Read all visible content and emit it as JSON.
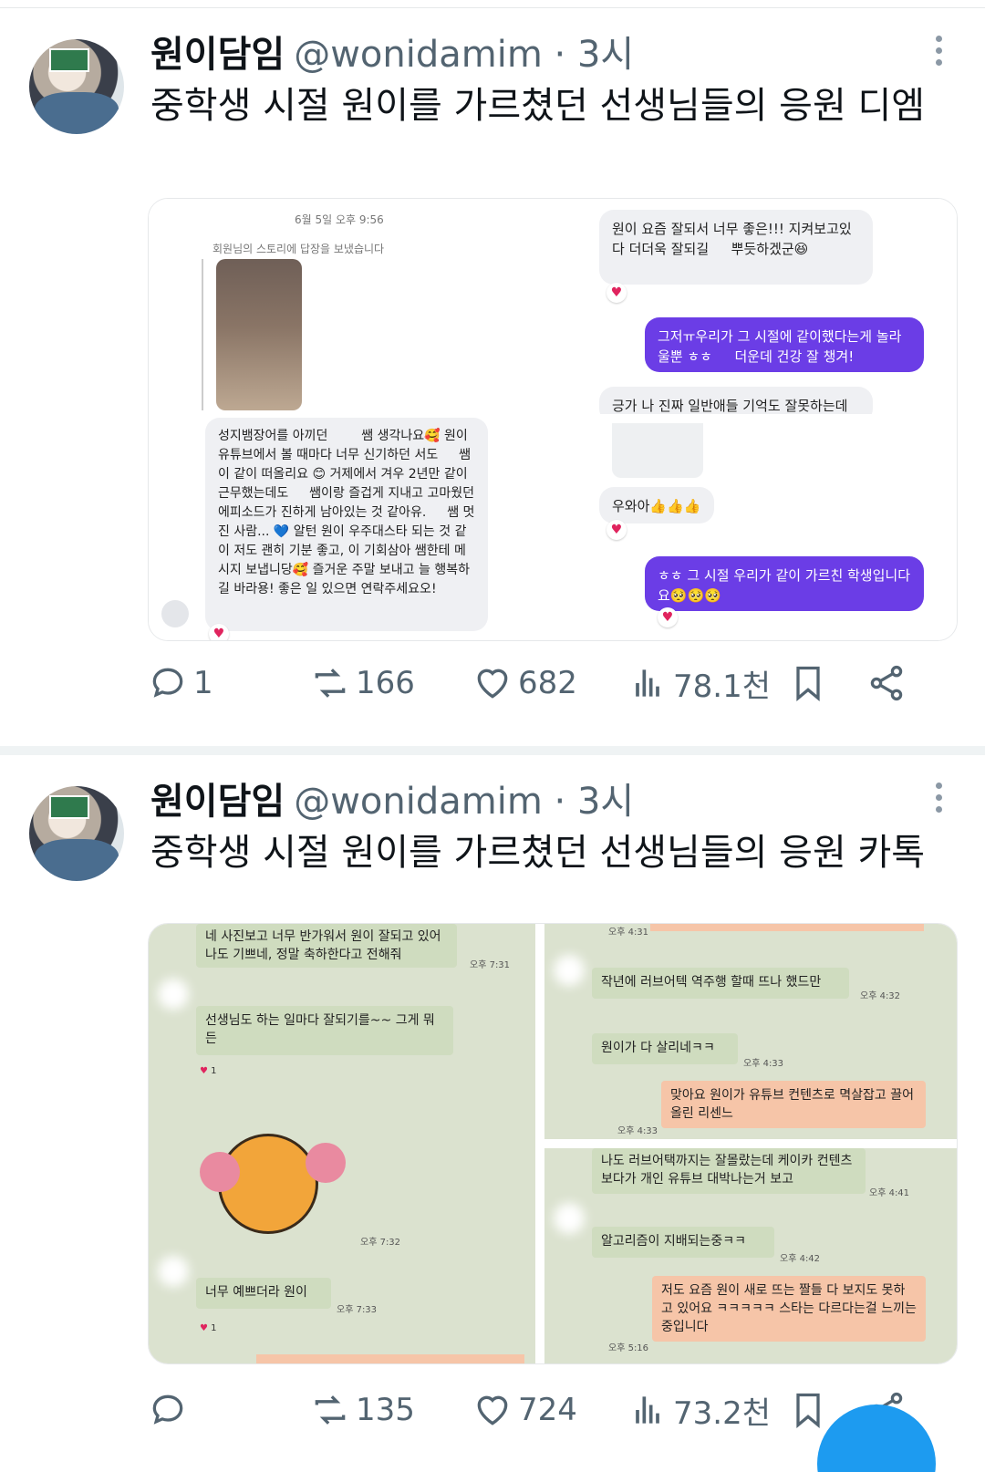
{
  "tweets": [
    {
      "author": "원이담임",
      "handle": "@wonidamim · 3시",
      "text": "중학생 시절 원이를 가르쳤던 선생님들의 응원 디엠",
      "stats": {
        "replies": "1",
        "reposts": "166",
        "likes": "682",
        "views": "78.1천"
      },
      "media": {
        "panel1": {
          "date": "6월 5일 오후 9:56",
          "story_reply": "회원님의 스토리에 답장을 보냈습니다",
          "message": "성지뱀장어를 아끼던 　　 쌤 생각나요🥰 원이 유튜브에서 볼 때마다 너무 신기하던 서도 　 쌤이 같이 떠올리요 😊 거제에서 겨우 2년만 같이 근무했는데도 　 쌤이랑 즐겁게 지내고 고마웠던 에피소드가 진하게 남아있는 것 같아유. 　 쌤 멋진 사람... 💙 알턴 원이 우주대스타 되는 것 같이 저도 괜히 기분 좋고, 이 기회삼아 쌤한테 메시지 보냅니당🥰 즐거운 주말 보내고 늘 행복하길 바라용! 좋은 일 있으면 연락주세요오!"
        },
        "panel2": {
          "msg1": "원이 요즘 잘되서 너무 좋은!!! 지켜보고있다 더더욱 잘되길 　 뿌듯하겠군😆",
          "msg2": "그저ㅠ우리가 그 시절에 같이했다는게 놀라울뿐 ㅎㅎ 　 더운데 건강 잘 챙겨!",
          "msg3": "긍가 나 진짜 일반애들 기억도 잘못하는데"
        },
        "panel3": {
          "msg1": "우와아👍👍👍",
          "msg2": "ㅎㅎ 그 시절 우리가 같이 가르친 학생입니다요🥺🥺🥺"
        }
      }
    },
    {
      "author": "원이담임",
      "handle": "@wonidamim · 3시",
      "text": "중학생 시절 원이를 가르쳤던 선생님들의 응원 카톡",
      "stats": {
        "replies": "",
        "reposts": "135",
        "likes": "724",
        "views": "73.2천"
      },
      "media": {
        "panel1": {
          "msg1": "네 사진보고 너무 반가워서 원이 잘되고 있어 나도 기쁘네, 정말 축하한다고 전해줘",
          "time1": "오후 7:31",
          "msg2": "선생님도 하는 일마다 잘되기를~~ 그게 뭐든",
          "react1": "1",
          "time2": "오후 7:32",
          "msg3": "너무 예쁘더라 원이",
          "time3": "오후 7:33",
          "react2": "1"
        },
        "panel2": {
          "time0": "오후 4:31",
          "msg1": "작년에 러브어텍 역주행 할때 뜨나 했드만",
          "time1": "오후 4:32",
          "msg2": "원이가 다 살리네ㅋㅋ",
          "time2": "오후 4:33",
          "msg3": "맞아요 원이가 유튜브 컨텐츠로 멱살잡고 끌어올린 리센느",
          "time3": "오후 4:33"
        },
        "panel3": {
          "msg1": "나도 러브어택까지는 잘몰랐는데 케이카 컨텐츠 보다가 개인 유튜브 대박나는거 보고",
          "time1": "오후 4:41",
          "msg2": "알고리즘이 지배되는중ㅋㅋ",
          "time2": "오후 4:42",
          "msg3": "저도 요즘 원이 새로 뜨는 짤들 다 보지도 못하고 있어요 ㅋㅋㅋㅋㅋ 스타는 다르다는걸 느끼는 중입니다",
          "time3": "오후 5:16"
        }
      }
    }
  ],
  "colors": {
    "accent": "#1d9bf0",
    "purple": "#6b3de6",
    "kakao_bg": "#dbe2cf",
    "text_secondary": "#536471"
  }
}
